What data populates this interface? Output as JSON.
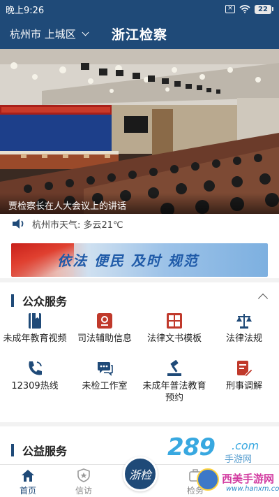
{
  "status_bar": {
    "time": "晚上9:26",
    "battery": "22"
  },
  "header": {
    "location": "杭州市 上城区",
    "title": "浙江检察"
  },
  "hero": {
    "caption": "贾检察长在人大会议上的讲话"
  },
  "weather": {
    "text": "杭州市天气: 多云21℃"
  },
  "banner": {
    "slogan": "依法  便民  及时  规范"
  },
  "public_services": {
    "title": "公众服务",
    "items": [
      {
        "label": "未成年教育视频",
        "icon": "book-icon"
      },
      {
        "label": "司法辅助信息",
        "icon": "info-card-icon"
      },
      {
        "label": "法律文书模板",
        "icon": "document-grid-icon"
      },
      {
        "label": "法律法规",
        "icon": "scales-icon"
      },
      {
        "label": "12309热线",
        "icon": "phone-icon"
      },
      {
        "label": "未检工作室",
        "icon": "chat-icon"
      },
      {
        "label": "未成年普法教育预约",
        "icon": "gavel-icon"
      },
      {
        "label": "刑事调解",
        "icon": "edit-doc-icon"
      }
    ]
  },
  "public_welfare": {
    "title": "公益服务"
  },
  "bottom_nav": {
    "items": [
      {
        "label": "首页",
        "icon": "home-icon",
        "active": true
      },
      {
        "label": "信访",
        "icon": "badge-icon",
        "active": false
      },
      {
        "label": "浙检",
        "icon": "center-logo",
        "active": false
      },
      {
        "label": "检务",
        "icon": "case-icon",
        "active": false
      }
    ]
  },
  "watermark": {
    "brand": "289",
    "domain": ".com",
    "sub": "手游网",
    "name": "西美手游网",
    "url": "www.hanxm.com"
  },
  "colors": {
    "primary": "#1f4a78",
    "accent": "#c0392b",
    "banner_text": "#1f5aa8"
  }
}
